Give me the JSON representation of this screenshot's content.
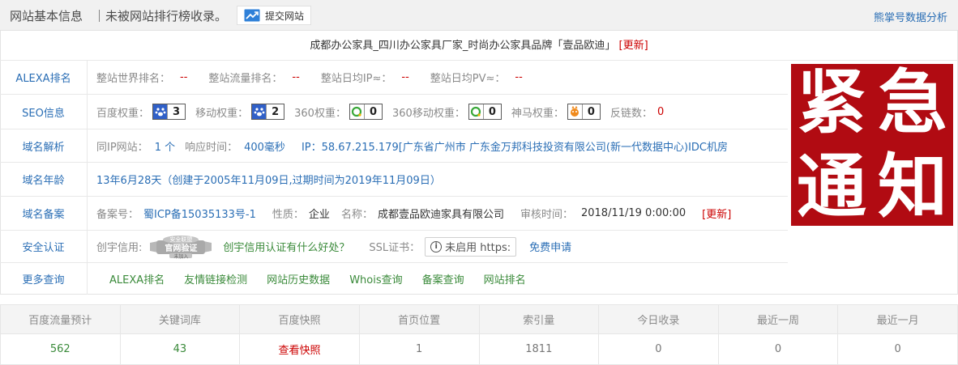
{
  "header": {
    "title": "网站基本信息",
    "subtitle": "｜未被网站排行榜收录。",
    "submit_label": "提交网站",
    "right_link": "熊掌号数据分析"
  },
  "site": {
    "title": "成都办公家具_四川办公家具厂家_时尚办公家具品牌「壹品欧迪」",
    "update_label": "[更新]"
  },
  "alexa": {
    "label": "ALEXA排名",
    "world_rank_k": "整站世界排名：",
    "world_rank_v": "--",
    "traffic_rank_k": "整站流量排名：",
    "traffic_rank_v": "--",
    "daily_ip_k": "整站日均IP≈：",
    "daily_ip_v": "--",
    "daily_pv_k": "整站日均PV≈：",
    "daily_pv_v": "--"
  },
  "seo": {
    "label": "SEO信息",
    "baidu_k": "百度权重：",
    "baidu_v": "3",
    "mobile_k": "移动权重：",
    "mobile_v": "2",
    "s360_k": "360权重：",
    "s360_v": "0",
    "s360m_k": "360移动权重：",
    "s360m_v": "0",
    "shenma_k": "神马权重：",
    "shenma_v": "0",
    "backlinks_k": "反链数：",
    "backlinks_v": "0"
  },
  "dns": {
    "label": "域名解析",
    "sameip_k": "同IP网站：",
    "sameip_v": "1 个",
    "resp_k": "响应时间：",
    "resp_v": "400毫秒",
    "ip_v": "IP：58.67.215.179[广东省广州市 广东金万邦科技投资有限公司(新一代数据中心)IDC机房"
  },
  "age": {
    "label": "域名年龄",
    "value": "13年6月28天（创建于2005年11月09日,过期时间为2019年11月09日）"
  },
  "icp": {
    "label": "域名备案",
    "num_k": "备案号：",
    "num_v": "蜀ICP备15035133号-1",
    "type_k": "性质：",
    "type_v": "企业",
    "name_k": "名称：",
    "name_v": "成都壹品欧迪家具有限公司",
    "date_k": "审核时间：",
    "date_v": "2018/11/19 0:00:00",
    "update_label": "[更新]"
  },
  "security": {
    "label": "安全认证",
    "credit_k": "创宇信用:",
    "credit_badge_top": "安全联盟",
    "credit_badge_main": "官网验证",
    "credit_badge_sub": "未加入",
    "credit_link": "创宇信用认证有什么好处？",
    "ssl_k": "SSL证书：",
    "ssl_btn": "未启用 https:",
    "ssl_apply": "免费申请"
  },
  "more": {
    "label": "更多查询",
    "links": [
      "ALEXA排名",
      "友情链接检测",
      "网站历史数据",
      "Whois查询",
      "备案查询",
      "网站排名"
    ]
  },
  "notice": {
    "chars": [
      "紧",
      "急",
      "通",
      "知"
    ],
    "bg_color": "#b10b12"
  },
  "stats": {
    "headers": [
      "百度流量预计",
      "关键词库",
      "百度快照",
      "首页位置",
      "索引量",
      "今日收录",
      "最近一周",
      "最近一月"
    ],
    "values": [
      "562",
      "43",
      "查看快照",
      "1",
      "1811",
      "0",
      "0",
      "0"
    ]
  },
  "colors": {
    "link_blue": "#2a6eb5",
    "link_green": "#3a8a3a",
    "alert_red": "#cc0000"
  }
}
